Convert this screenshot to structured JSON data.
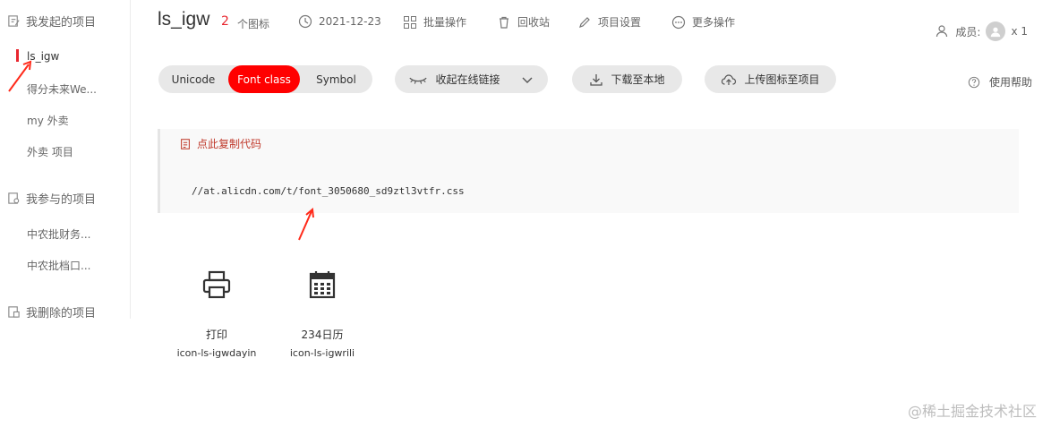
{
  "sidebar": {
    "my_projects_title": "我发起的项目",
    "my_projects": [
      "ls_igw",
      "得分未来We...",
      "my 外卖",
      "外卖 项目"
    ],
    "joined_title": "我参与的项目",
    "joined": [
      "中农批财务...",
      "中农批档口..."
    ],
    "deleted_title": "我删除的项目"
  },
  "header": {
    "title": "ls_igw",
    "icon_count": "2",
    "icon_count_label": "个图标",
    "date": "2021-12-23",
    "batch": "批量操作",
    "recycle": "回收站",
    "settings": "项目设置",
    "more": "更多操作",
    "members_label": "成员:",
    "members_count": "x 1"
  },
  "toolbar": {
    "tabs": [
      "Unicode",
      "Font class",
      "Symbol"
    ],
    "active_tab": "Font class",
    "collapse_link": "收起在线链接",
    "download": "下载至本地",
    "upload": "上传图标至项目",
    "help": "使用帮助"
  },
  "code": {
    "copy_label": "点此复制代码",
    "url": "//at.alicdn.com/t/font_3050680_sd9ztl3vtfr.css"
  },
  "icons": [
    {
      "name": "打印",
      "class": "icon-ls-igwdayin",
      "icon": "printer-icon"
    },
    {
      "name": "234日历",
      "class": "icon-ls-igwrili",
      "icon": "calendar-icon"
    }
  ],
  "watermark": "@稀土掘金技术社区",
  "colors": {
    "accent": "#ff0000",
    "annotation": "#ff2a1a"
  }
}
